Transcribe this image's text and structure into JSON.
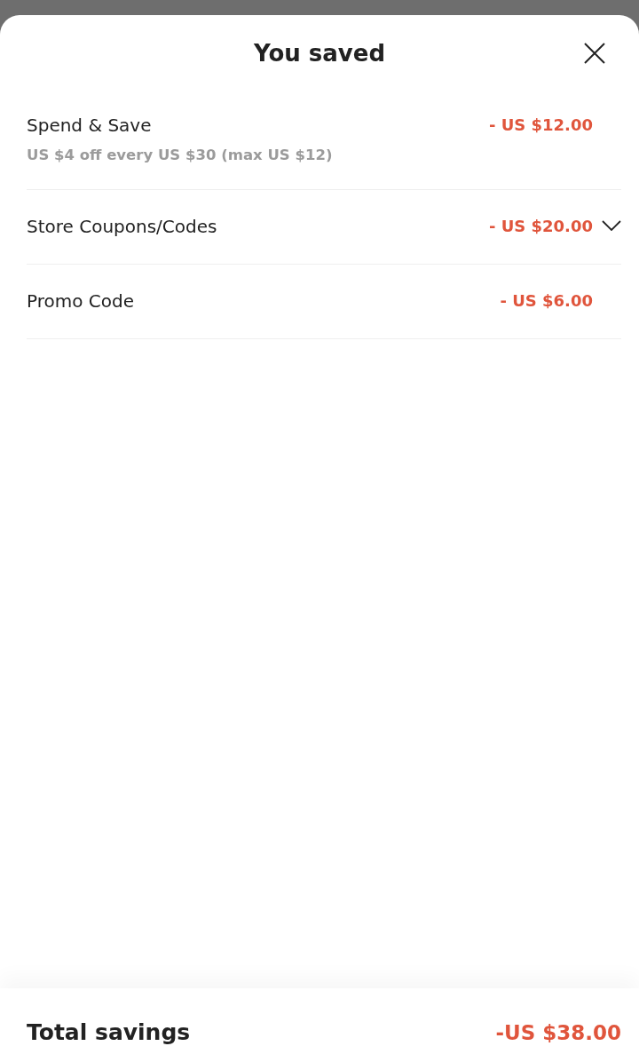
{
  "sheet": {
    "title": "You saved"
  },
  "discounts": [
    {
      "kind": "plain",
      "label": "Spend & Save",
      "description": "US $4 off every US $30 (max US $12)",
      "amount": "- US $12.00"
    },
    {
      "kind": "collapsible",
      "label": "Store Coupons/Codes",
      "amount": "- US $20.00",
      "expanded": false
    },
    {
      "kind": "plain",
      "label": "Promo Code",
      "amount": "- US $6.00"
    }
  ],
  "total": {
    "label": "Total savings",
    "amount": "-US $38.00"
  }
}
